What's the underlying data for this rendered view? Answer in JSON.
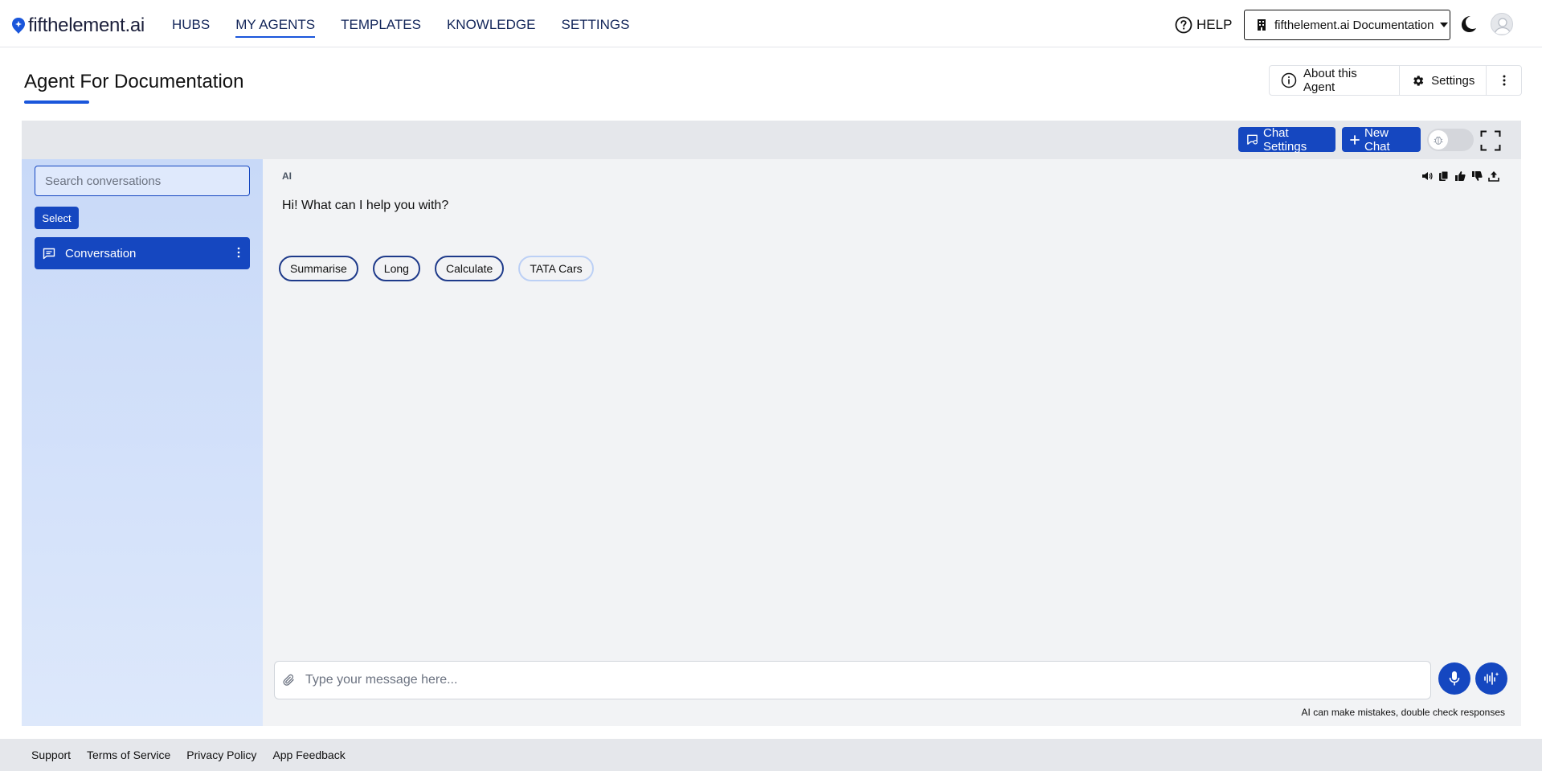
{
  "brand": {
    "name": "fifthelement.ai",
    "accent": "#1547c0"
  },
  "nav": {
    "items": [
      {
        "label": "HUBS",
        "active": false
      },
      {
        "label": "MY AGENTS",
        "active": true
      },
      {
        "label": "TEMPLATES",
        "active": false
      },
      {
        "label": "KNOWLEDGE",
        "active": false
      },
      {
        "label": "SETTINGS",
        "active": false
      }
    ],
    "help_label": "HELP",
    "org_selector": "fifthelement.ai Documentation"
  },
  "page": {
    "title": "Agent For Documentation",
    "about_label": "About this Agent",
    "settings_label": "Settings"
  },
  "chat": {
    "chat_settings_label": "Chat Settings",
    "new_chat_label": "New Chat",
    "search_placeholder": "Search conversations",
    "select_label": "Select",
    "conversations": [
      {
        "label": "Conversation"
      }
    ],
    "sender_label": "AI",
    "ai_message": "Hi! What can I help you with?",
    "suggestions": [
      "Summarise",
      "Long",
      "Calculate",
      "TATA Cars"
    ],
    "input_placeholder": "Type your message here...",
    "disclaimer": "AI can make mistakes, double check responses"
  },
  "footer": {
    "links": [
      "Support",
      "Terms of Service",
      "Privacy Policy",
      "App Feedback"
    ]
  },
  "icons": [
    "logo-icon",
    "help-icon",
    "building-icon",
    "moon-icon",
    "avatar-icon",
    "info-icon",
    "gear-icon",
    "more-vertical-icon",
    "chat-settings-icon",
    "plus-icon",
    "bug-icon",
    "fullscreen-icon",
    "chat-bubble-icon",
    "speaker-icon",
    "copy-icon",
    "thumbs-up-icon",
    "thumbs-down-icon",
    "share-icon",
    "paperclip-icon",
    "mic-icon",
    "voice-icon"
  ]
}
